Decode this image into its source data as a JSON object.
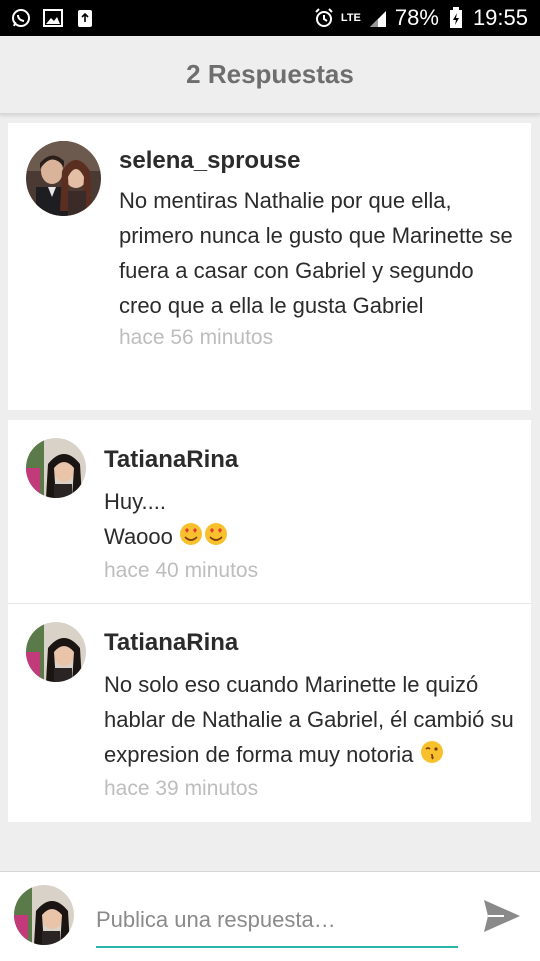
{
  "status_bar": {
    "left_icons": [
      "whatsapp-icon",
      "image-icon",
      "recycle-icon"
    ],
    "alarm_icon": "alarm-icon",
    "network": "LTE",
    "battery": "78%",
    "time": "19:55"
  },
  "header": {
    "title": "2 Respuestas"
  },
  "comments": [
    {
      "username": "selena_sprouse",
      "text": "No mentiras Nathalie por que ella, primero nunca le gusto que Marinette se fuera a casar con Gabriel y segundo creo que a ella le gusta Gabriel",
      "time": "hace 56 minutos"
    },
    {
      "username": "TatianaRina",
      "line1": "Huy....",
      "line2": "Waooo",
      "emoji": "heart-eyes-emoji",
      "time": "hace 40 minutos"
    },
    {
      "username": "TatianaRina",
      "text": "No solo eso cuando Marinette le quizó hablar de Nathalie a Gabriel, él cambió su expresion de forma muy notoria",
      "emoji": "winking-kiss-emoji",
      "time": "hace 39 minutos"
    }
  ],
  "reply": {
    "placeholder": "Publica una respuesta…"
  },
  "colors": {
    "accent": "#2ab5aa",
    "header_text": "#6e6e6e",
    "time_text": "#bdbdbd"
  }
}
